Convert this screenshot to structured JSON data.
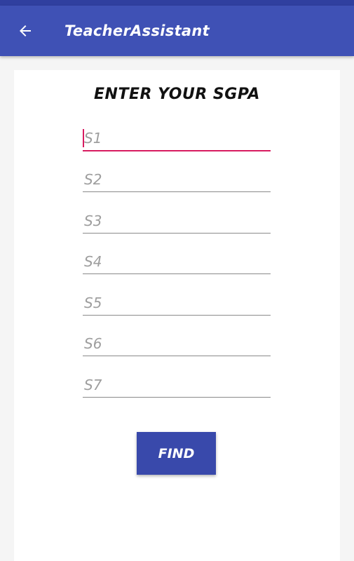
{
  "app_bar": {
    "title": "TeacherAssistant",
    "back_icon": "arrow-left-icon",
    "color": "#3f51b5",
    "status_color": "#303f9f"
  },
  "form": {
    "heading": "ENTER YOUR SGPA",
    "fields": [
      {
        "placeholder": "S1",
        "value": "",
        "focused": true
      },
      {
        "placeholder": "S2",
        "value": ""
      },
      {
        "placeholder": "S3",
        "value": ""
      },
      {
        "placeholder": "S4",
        "value": ""
      },
      {
        "placeholder": "S5",
        "value": ""
      },
      {
        "placeholder": "S6",
        "value": ""
      },
      {
        "placeholder": "S7",
        "value": ""
      }
    ],
    "accent_color": "#d81b60",
    "find_label": "FIND",
    "button_color": "#3949ab"
  }
}
